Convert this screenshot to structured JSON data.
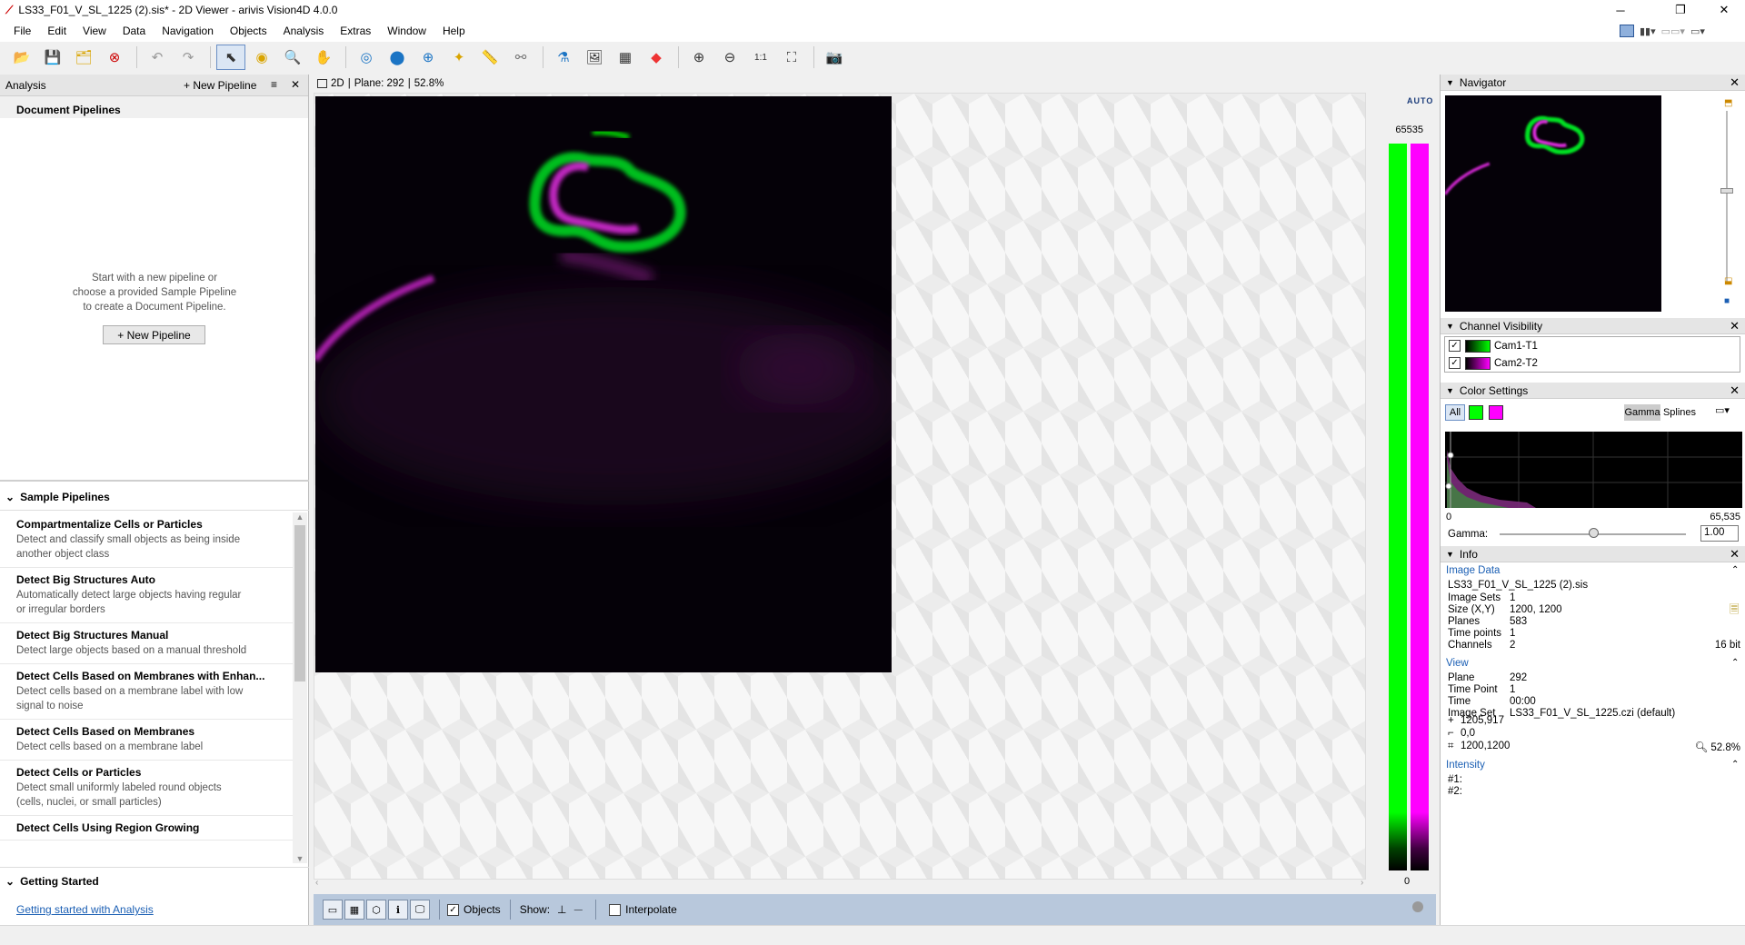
{
  "window": {
    "title": "LS33_F01_V_SL_1225 (2).sis* - 2D Viewer - arivis Vision4D 4.0.0"
  },
  "menu": [
    "File",
    "Edit",
    "View",
    "Data",
    "Navigation",
    "Objects",
    "Analysis",
    "Extras",
    "Window",
    "Help"
  ],
  "toolbar": {
    "icons": [
      "open-icon",
      "save-icon",
      "save-all-icon",
      "close-doc-icon",
      "undo-icon",
      "redo-icon",
      "select-pointer-icon",
      "draw-tool-icon",
      "zoom-tool-icon",
      "pan-hand-icon",
      "rotate-icon",
      "object-tool-icon",
      "magic-zoom-icon",
      "magic-wand-icon",
      "ruler-icon",
      "graph-icon",
      "flask-icon",
      "image-add-icon",
      "table-icon",
      "color-wheel-icon",
      "zoom-in-icon",
      "zoom-out-icon",
      "zoom-1to1-icon",
      "fit-icon",
      "camera-icon"
    ]
  },
  "analysis": {
    "title": "Analysis",
    "new_pipeline_header": "+ New Pipeline",
    "doc_pipelines_title": "Document Pipelines",
    "empty_line1": "Start with a new pipeline or",
    "empty_line2": "choose a provided Sample Pipeline",
    "empty_line3": "to create a Document Pipeline.",
    "new_pipeline_button": "+ New Pipeline",
    "sample_pipelines_title": "Sample Pipelines",
    "sample_pipelines": [
      {
        "title": "Compartmentalize Cells or Particles",
        "desc1": "Detect and classify small objects as being inside",
        "desc2": "another object class"
      },
      {
        "title": "Detect Big Structures Auto",
        "desc1": "Automatically detect large objects having regular",
        "desc2": "or irregular borders"
      },
      {
        "title": "Detect Big Structures Manual",
        "desc1": "Detect large objects based on a manual threshold",
        "desc2": ""
      },
      {
        "title": "Detect Cells Based on Membranes with Enhan...",
        "desc1": "Detect cells based on a membrane label with low",
        "desc2": "signal to noise"
      },
      {
        "title": "Detect Cells Based on Membranes",
        "desc1": "Detect cells based on a membrane label",
        "desc2": ""
      },
      {
        "title": "Detect Cells or Particles",
        "desc1": "Detect small uniformly labeled round objects",
        "desc2": "(cells, nuclei, or small particles)"
      },
      {
        "title": "Detect Cells Using Region Growing",
        "desc1": "",
        "desc2": ""
      }
    ],
    "getting_started_title": "Getting Started",
    "getting_started_link": "Getting started with Analysis"
  },
  "viewer": {
    "mode": "2D",
    "plane_label": "Plane: 292",
    "zoom_label": "52.8%",
    "auto_label": "AUTO",
    "scale_max": "65535",
    "scale_min": "0",
    "objects_label": "Objects",
    "show_label": "Show:",
    "interpolate_label": "Interpolate",
    "colors": {
      "green": "#00ff00",
      "magenta": "#ff00ff"
    }
  },
  "navigator": {
    "title": "Navigator"
  },
  "channel_visibility": {
    "title": "Channel Visibility",
    "channels": [
      {
        "name": "Cam1-T1",
        "color": "#00ff00"
      },
      {
        "name": "Cam2-T2",
        "color": "#ff00ff"
      }
    ]
  },
  "color_settings": {
    "title": "Color Settings",
    "all_label": "All",
    "gamma_tab": "Gamma",
    "splines_tab": "Splines",
    "range_min": "0",
    "range_max": "65,535",
    "gamma_label": "Gamma:",
    "gamma_value": "1.00"
  },
  "info": {
    "title": "Info",
    "image_data_title": "Image Data",
    "file_name": "LS33_F01_V_SL_1225 (2).sis",
    "image_data": [
      {
        "k": "Image Sets",
        "v": "1"
      },
      {
        "k": "Size (X,Y)",
        "v": "1200, 1200"
      },
      {
        "k": "Planes",
        "v": "583"
      },
      {
        "k": "Time points",
        "v": "1"
      },
      {
        "k": "Channels",
        "v": "2"
      }
    ],
    "bit_depth": "16 bit",
    "view_title": "View",
    "view": [
      {
        "k": "Plane",
        "v": "292"
      },
      {
        "k": "Time Point",
        "v": "1"
      },
      {
        "k": "Time",
        "v": "00:00"
      },
      {
        "k": "Image Set",
        "v": "LS33_F01_V_SL_1225.czi (default)"
      }
    ],
    "cursor_pos": "1205,917",
    "origin": "0,0",
    "extent": "1200,1200",
    "zoom": "52.8%",
    "intensity_title": "Intensity",
    "intensity": [
      "#1:",
      "#2:"
    ]
  }
}
